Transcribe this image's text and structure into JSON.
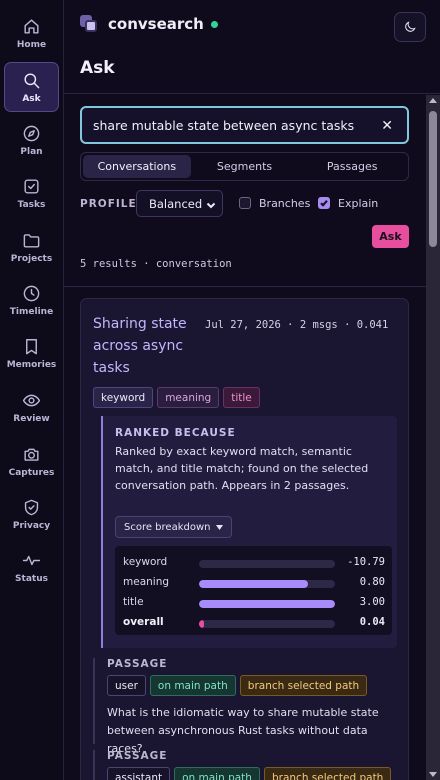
{
  "rail": [
    {
      "label": "Home",
      "icon": "home-icon"
    },
    {
      "label": "Ask",
      "icon": "search-icon",
      "active": true
    },
    {
      "label": "Plan",
      "icon": "compass-icon"
    },
    {
      "label": "Tasks",
      "icon": "checkbox-icon"
    },
    {
      "label": "Projects",
      "icon": "folder-icon"
    },
    {
      "label": "Timeline",
      "icon": "clock-icon"
    },
    {
      "label": "Memories",
      "icon": "bookmark-icon"
    },
    {
      "label": "Review",
      "icon": "eye-icon"
    },
    {
      "label": "Captures",
      "icon": "camera-icon"
    },
    {
      "label": "Privacy",
      "icon": "shield-check-icon"
    },
    {
      "label": "Status",
      "icon": "activity-icon"
    }
  ],
  "header": {
    "app_name": "convsearch",
    "page_title": "Ask",
    "status_color": "#34d399"
  },
  "search": {
    "value": "share mutable state between async tasks"
  },
  "tabs": [
    {
      "label": "Conversations",
      "active": true
    },
    {
      "label": "Segments"
    },
    {
      "label": "Passages"
    }
  ],
  "profile": {
    "label": "PROFILE",
    "selected": "Balanced",
    "branches_label": "Branches",
    "branches_checked": false,
    "explain_label": "Explain",
    "explain_checked": true
  },
  "ask_label": "Ask",
  "results_summary": "5 results · conversation",
  "result": {
    "title": "Sharing state across async tasks",
    "meta": "Jul 27, 2026 · 2 msgs · 0.041",
    "chips": [
      "keyword",
      "meaning",
      "title"
    ],
    "ranked_heading": "RANKED BECAUSE",
    "ranked_text": "Ranked by exact keyword match, semantic match, and title match; found on the selected conversation path. Appears in 2 passages.",
    "breakdown_label": "Score breakdown",
    "scores": [
      {
        "label": "keyword",
        "value": "-10.79",
        "fill": 0
      },
      {
        "label": "meaning",
        "value": "0.80",
        "fill": 0.8
      },
      {
        "label": "title",
        "value": "3.00",
        "fill": 1.0
      },
      {
        "label": "overall",
        "value": "0.04",
        "fill": 0.04
      }
    ],
    "passages": [
      {
        "heading": "PASSAGE",
        "role": "user",
        "main_label": "on main path",
        "branch_label": "branch selected path",
        "text": "What is the idiomatic way to share mutable state between asynchronous Rust tasks without data races?"
      },
      {
        "heading": "PASSAGE",
        "role": "assistant",
        "main_label": "on main path",
        "branch_label": "branch selected path",
        "text": ""
      }
    ]
  },
  "colors": {
    "accent": "#a78bfa",
    "pink": "#e84e9e",
    "focus": "#82c8dc"
  }
}
